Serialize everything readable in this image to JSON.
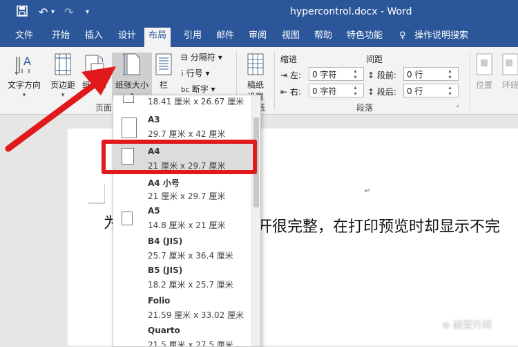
{
  "titlebar": {
    "title": "hypercontrol.docx  -  Word",
    "save_icon": "save-icon",
    "undo_icon": "undo-icon",
    "redo_icon": "redo-icon",
    "customize_icon": "customize-qat-icon"
  },
  "tabs": [
    "文件",
    "开始",
    "插入",
    "设计",
    "布局",
    "引用",
    "邮件",
    "审阅",
    "视图",
    "帮助",
    "特色功能"
  ],
  "active_tab": "布局",
  "tell_me": "操作说明搜索",
  "ribbon": {
    "text_direction": "文字方向",
    "margins": "页边距",
    "orientation": "纸张方",
    "size": "纸张大小",
    "columns": "栏",
    "breaks": "分隔符",
    "line_numbers": "行号",
    "hyphenation": "断字",
    "manuscript_line1": "稿纸",
    "manuscript_line2": "设置",
    "group_page_setup": "页面",
    "group_manuscript": "纸",
    "indent_label": "缩进",
    "spacing_label": "间距",
    "indent_left_label": "左:",
    "indent_left_value": "0 字符",
    "indent_right_label": "右:",
    "indent_right_value": "0 字符",
    "space_before_label": "段前:",
    "space_before_value": "0 行",
    "space_after_label": "段后:",
    "space_after_value": "0 行",
    "group_paragraph": "段落",
    "position": "位置",
    "wrap": "环绕"
  },
  "paper_sizes": [
    {
      "name": "",
      "size": "18.41 厘米 x 26.67 厘米"
    },
    {
      "name": "A3",
      "size": "29.7 厘米 x 42 厘米"
    },
    {
      "name": "A4",
      "size": "21 厘米 x 29.7 厘米"
    },
    {
      "name": "A4 小号",
      "size": "21 厘米 x 29.7 厘米"
    },
    {
      "name": "A5",
      "size": "14.8 厘米 x 21 厘米"
    },
    {
      "name": "B4 (JIS)",
      "size": "25.7 厘米 x 36.4 厘米"
    },
    {
      "name": "B5 (JIS)",
      "size": "18.2 厘米 x 25.7 厘米"
    },
    {
      "name": "Folio",
      "size": "21.59 厘米 x 33.02 厘米"
    },
    {
      "name": "Quarto",
      "size": "21.5 厘米 x 27.5 厘米"
    }
  ],
  "selected_paper": "A4",
  "document_text": "开很完整，在打印预览时却显示不完",
  "watermark": "⊚ 硫壁升辉",
  "colors": {
    "accent": "#2b579a",
    "highlight": "#e0191d"
  }
}
